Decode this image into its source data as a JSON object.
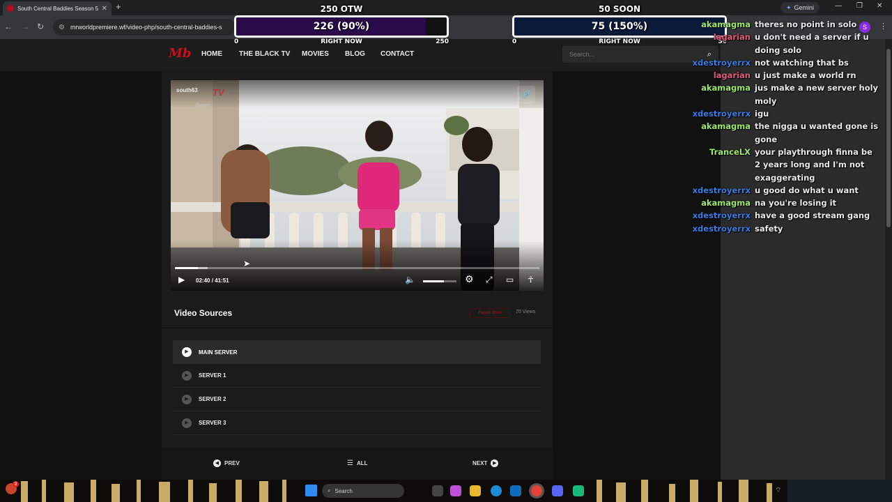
{
  "browser": {
    "tab_title": "South Central Baddies Season 5",
    "url": "mrworldpremiere.wf/video-php/south-central-baddies-s",
    "gemini_label": "Gemini",
    "profile_letter": "S"
  },
  "goals": [
    {
      "title": "250 OTW",
      "value_text": "226 (90%)",
      "min": "0",
      "max": "250",
      "caption": "RIGHT NOW",
      "fill": 0.9,
      "color": "#2a0a4a"
    },
    {
      "title": "50 SOON",
      "value_text": "75 (150%)",
      "min": "0",
      "max": "50",
      "caption": "RIGHT NOW",
      "fill": 1.0,
      "color": "#0c1a3a"
    }
  ],
  "site": {
    "logo": "Mb",
    "nav": [
      "HOME",
      "THE BLACK TV",
      "MOVIES",
      "BLOG",
      "CONTACT"
    ],
    "search_placeholder": "Search..."
  },
  "player": {
    "watermark": "south63",
    "watermark_brand": "TV",
    "watermark_sub": "Видео",
    "current_time": "02:40",
    "duration": "41:51",
    "progress": 0.064,
    "volume": 0.62
  },
  "sources": {
    "heading": "Video Sources",
    "report_label": "Report Error",
    "views": "70 Views",
    "servers": [
      {
        "label": "MAIN SERVER",
        "active": true
      },
      {
        "label": "SERVER 1",
        "active": false
      },
      {
        "label": "SERVER 2",
        "active": false
      },
      {
        "label": "SERVER 3",
        "active": false
      }
    ],
    "prev": "PREV",
    "all": "ALL",
    "next": "NEXT"
  },
  "chat": [
    {
      "user": "akamagma",
      "color": "#9fe870",
      "text": "theres no point in solo"
    },
    {
      "user": "lagarian",
      "color": "#e05a7a",
      "text": "u don't need a server if u doing solo"
    },
    {
      "user": "xdestroyerrx",
      "color": "#3a7be0",
      "text": "not watching that bs"
    },
    {
      "user": "lagarian",
      "color": "#e05a7a",
      "text": "u just make a world rn"
    },
    {
      "user": "akamagma",
      "color": "#9fe870",
      "text": "jus make a new server holy moly"
    },
    {
      "user": "xdestroyerrx",
      "color": "#3a7be0",
      "text": "igu"
    },
    {
      "user": "akamagma",
      "color": "#9fe870",
      "text": "the nigga u wanted gone is gone"
    },
    {
      "user": "TranceLX",
      "color": "#9fe870",
      "text": "your playthrough finna be 2 years long and I'm not exaggerating"
    },
    {
      "user": "xdestroyerrx",
      "color": "#3a7be0",
      "text": "u good do what u want"
    },
    {
      "user": "akamagma",
      "color": "#9fe870",
      "text": "na you're losing it"
    },
    {
      "user": "xdestroyerrx",
      "color": "#3a7be0",
      "text": "have a good stream gang"
    },
    {
      "user": "xdestroyerrx",
      "color": "#3a7be0",
      "text": "safety"
    }
  ],
  "taskbar": {
    "search_placeholder": "Search",
    "notification_count": "3"
  }
}
